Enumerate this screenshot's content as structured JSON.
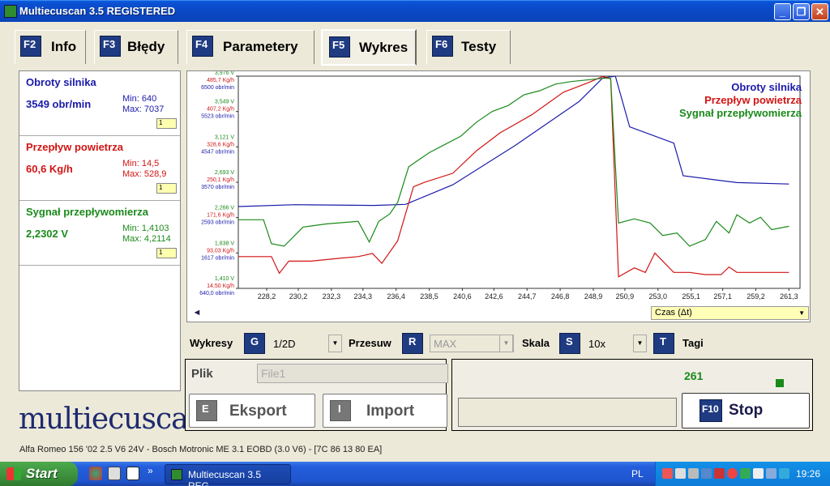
{
  "window": {
    "title": "Multiecuscan 3.5 REGISTERED"
  },
  "tabs": [
    {
      "key": "F2",
      "label": "Info"
    },
    {
      "key": "F3",
      "label": "Błędy"
    },
    {
      "key": "F4",
      "label": "Parametery"
    },
    {
      "key": "F5",
      "label": "Wykres",
      "active": true
    },
    {
      "key": "F6",
      "label": "Testy"
    }
  ],
  "sensors": [
    {
      "name": "Obroty silnika",
      "value": "3549 obr/min",
      "min": "Min: 640",
      "max": "Max: 7037",
      "bar": "1",
      "color": "#1A1AAA"
    },
    {
      "name": "Przepływ powietrza",
      "value": "60,6 Kg/h",
      "min": "Min: 14,5",
      "max": "Max: 528,9",
      "bar": "1",
      "color": "#D21414"
    },
    {
      "name": "Sygnał przepływomierza",
      "value": "2,2302 V",
      "min": "Min: 1,4103",
      "max": "Max: 4,2114",
      "bar": "1",
      "color": "#1A8A1A"
    }
  ],
  "logo": "multiecuscan",
  "chart_data": {
    "type": "line",
    "x_ticks": [
      "228,2",
      "230,2",
      "232,3",
      "234,3",
      "236,4",
      "238,5",
      "240,6",
      "242,6",
      "244,7",
      "246,8",
      "248,9",
      "250,9",
      "253,0",
      "255,1",
      "257,1",
      "259,2",
      "261,3"
    ],
    "y_ticks": [
      {
        "v": "3,976 V",
        "k": "485,7 Kg/h",
        "r": "6500 obr/min"
      },
      {
        "v": "3,549 V",
        "k": "407,2 Kg/h",
        "r": "5523 obr/min"
      },
      {
        "v": "3,121 V",
        "k": "328,6 Kg/h",
        "r": "4547 obr/min"
      },
      {
        "v": "2,693 V",
        "k": "250,1 Kg/h",
        "r": "3570 obr/min"
      },
      {
        "v": "2,266 V",
        "k": "171,6 Kg/h",
        "r": "2593 obr/min"
      },
      {
        "v": "1,838 V",
        "k": "93,03 Kg/h",
        "r": "1617 obr/min"
      },
      {
        "v": "1,410 V",
        "k": "14,50 Kg/h",
        "r": "640,0 obr/min"
      }
    ],
    "xlim": [
      226.4,
      262.0
    ],
    "series": [
      {
        "name": "Obroty silnika",
        "color": "#1A1AAA",
        "unit": "obr/min",
        "ylim": [
          640,
          6500
        ],
        "x": [
          226.4,
          230,
          235,
          237,
          240,
          244,
          248,
          249.5,
          250.3,
          251.2,
          254,
          254.6,
          258,
          261.3
        ],
        "y": [
          2900,
          2950,
          2930,
          2960,
          3500,
          4600,
          5800,
          6450,
          6600,
          5100,
          4650,
          3750,
          3560,
          3520
        ]
      },
      {
        "name": "Przepływ powietrza",
        "color": "#D21414",
        "unit": "Kg/h",
        "ylim": [
          14.5,
          485.7
        ],
        "x": [
          226.4,
          228.5,
          229.0,
          229.6,
          231,
          233,
          234,
          234.9,
          235.5,
          236.5,
          237.5,
          238.2,
          240,
          241.5,
          243,
          245,
          247,
          248.5,
          249.5,
          250.0,
          250.5,
          251.5,
          252.2,
          252.8,
          254,
          255,
          256,
          257,
          257.5,
          258,
          260,
          261.3
        ],
        "y": [
          85,
          85,
          48,
          75,
          75,
          82,
          85,
          92,
          70,
          120,
          240,
          250,
          270,
          320,
          360,
          400,
          450,
          470,
          485,
          480,
          40,
          60,
          50,
          93,
          50,
          50,
          45,
          45,
          62,
          50,
          50,
          50
        ]
      },
      {
        "name": "Sygnał przepływomierza",
        "color": "#1A8A1A",
        "unit": "V",
        "ylim": [
          1.41,
          3.976
        ],
        "x": [
          226.4,
          228,
          228.5,
          229.3,
          230.5,
          232,
          234,
          234.7,
          235.3,
          236,
          236.5,
          237.2,
          238.5,
          239.5,
          240.5,
          241.5,
          242.5,
          243.5,
          244.5,
          245.5,
          246.5,
          247.5,
          248.5,
          249.5,
          250.0,
          250.5,
          251.5,
          252.5,
          253.3,
          254.2,
          255,
          256,
          256.7,
          257.5,
          258,
          258.8,
          259.5,
          260.2,
          261.3
        ],
        "y": [
          2.24,
          2.24,
          1.95,
          1.92,
          2.15,
          2.19,
          2.22,
          1.97,
          2.22,
          2.31,
          2.45,
          2.88,
          3.05,
          3.15,
          3.25,
          3.42,
          3.55,
          3.62,
          3.75,
          3.8,
          3.88,
          3.91,
          3.93,
          3.95,
          3.95,
          2.2,
          2.25,
          2.2,
          2.05,
          2.08,
          1.92,
          2.0,
          2.22,
          2.08,
          2.3,
          2.2,
          2.27,
          2.12,
          2.16
        ]
      }
    ]
  },
  "scroll": {
    "left": "◄",
    "right": "►",
    "time_label": "Czas (Δt)"
  },
  "controls": {
    "wykresy_label": "Wykresy",
    "wykresy_key": "G",
    "wykresy_value": "1/2D",
    "przesuw_label": "Przesuw",
    "przesuw_key": "R",
    "przesuw_value": "MAX",
    "skala_label": "Skala",
    "skala_key": "S",
    "skala_value": "10x",
    "tagi_key": "T",
    "tagi_label": "Tagi"
  },
  "file": {
    "label": "Plik",
    "value": "File1",
    "export_key": "E",
    "export_label": "Eksport",
    "import_key": "I",
    "import_label": "Import"
  },
  "record": {
    "counter": "261",
    "stop_key": "F10",
    "stop_label": "Stop"
  },
  "status": "Alfa Romeo 156 '02 2.5 V6 24V - Bosch Motronic ME 3.1 EOBD (3.0 V6) - [7C 86 13 80 EA]",
  "taskbar": {
    "start": "Start",
    "task": "Multiecuscan 3.5 REG...",
    "lang": "PL",
    "clock": "19:26"
  }
}
